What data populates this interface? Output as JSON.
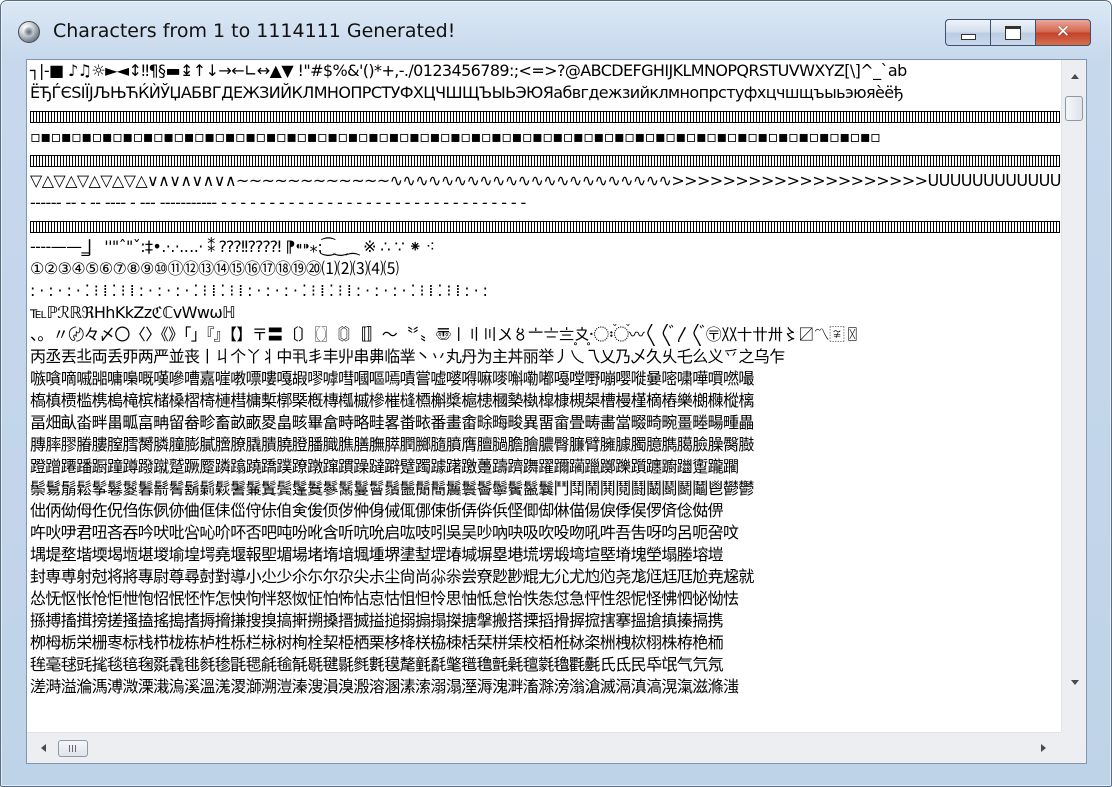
{
  "window": {
    "title": "Characters from 1 to 1114111 Generated!"
  },
  "content": {
    "lines": [
      {
        "text": " ┐|-■ ♪♫☼►◄↕‼¶§▬↨↑↓→←∟↔▲▼ !\"#$%&'()*+,-./0123456789:;<=>?@ABCDEFGHIJKLMNOPQRSTUVWXYZ[\\]^_`ab"
      },
      {
        "text": "ЁЂЃЄЅІЇЈЉЊЋЌЍЎЏАБВГДЕЖЗИЙКЛМНОПРСТУФХЦЧШЩЪЫЬЭЮЯабвгдежзийклмнопрстуфхцчшщъыьэюяѐёђ"
      },
      {
        "text": "",
        "box": true
      },
      {
        "text": "▫▪▫▪▫▪▫▪▫▪▫▪▫▪▫▪▫▪▫▪▫▪▫▪▫▪▫▪▫▪▫▪▫▪▫▪▫▪▫▪▫▪▫▪▫▪▫▪▫▪▫▪▫▪▫▪▫▪▫▪▫▪▫▪▫▪▫▪▫▪▫▪▫▪▫▪▫▪▫▪▫▪▫"
      },
      {
        "text": "",
        "box": true
      },
      {
        "text": "▽△▽△▽△▽△▽△∨∧∨∧∨∧∨∧~~~~~~~~~~~~∿∿∿∿∿∿∿∿∿∿∿∿∿∿∿∿∿∿∿∿∿∿>>>>>>>>>>>>>>>>>>>>ᑌᑌᑌᑌᑌᑌᑌᑌᑌᑌᑌᑌᑌᑌᑌᑌᑌ"
      },
      {
        "text": "------ -- - -- ---- - --- ----------- - - - - - - - - - - - - - - - - - - - - - - - - - - - - - - - -"
      },
      {
        "text": "",
        "box": true
      },
      {
        "text": "    ----——‗⎸''\"ˆ\"ˇ:‡•.·.·.‥.·   ⁑      ⁇⁈⁉⁇⁈    ⁋⁌⁍⁎⁏⁐‿⁔   ※  ∴  ∵   ⁕       ⁖      "
      },
      {
        "text": "                                                  ①②③④⑤⑥⑦⑧⑨⑩⑪⑫⑬⑭⑮⑯⑰⑱⑲⑳⑴⑵⑶⑷⑸"
      },
      {
        "text": ": · : · : · ⁚ ⁝ ⁞ ⁚ ⁝ ⁞ : · : · : · ⁚ ⁝ ⁞ ⁚ ⁝ ⁞ : · : · : · ⁚ ⁝ ⁞ ⁚ ⁝ ⁞ : · : · : · ⁚ ⁝ ⁞ ⁚ ⁝ ⁞ : · :"
      },
      {
        "text": "                                                   ℡ℙℛℝℜHhKkZzℭℂvWwѡℍ   "
      },
      {
        "text": "、。〃〄々〆〇〈〉《》「」『』【】〒〓〔〕〖〗〘〙〚〛〜〝〞〟〠〡〢〣〤〥〦〧〨〩〪〭〮〯〫〬〰〱〲〳〴〵〶〷〸〹〺〻〼〽〾〿"
      },
      {
        "text": "丙丞丟丠両丢丣两严並丧丨丩个丫丬中丮丯丰丱串丳临丵丶丷丸丹为主丼丽举丿乀乁乂乃乄久乆乇么义乊之乌乍"
      },
      {
        "text": "嗾嗿嘀嘁嘂嘃嘄嘅嘆嘇嘈嘉嘊嘋嘌嘍嘎嘏嘐嘑嘒嘓嘔嘕嘖嘗嘘嘙嘚嘛嘜嘝嘞嘟嘠嘡嘢嘣嘤嘥嘦嘧嘨嘩嘪嘫嘬"
      },
      {
        "text": "槗槙槚槛槜槝槞槟槠槡槢槣槤槥槦槧槨槩槪槫槬槭槮槯槰槱槲槳槴槵槶槷槸槹槺槻槼槽槾槿樀樁樂樃樄樅樆"
      },
      {
        "text": "畐畑畒畓畔畕畖畗畘留畚畛畜畝畞畟畠畡畢畣畤略畦畧畨畩番畫畬畭畮畯異畱畲畳畴畵當畷畸畹畺畻畼畽畾"
      },
      {
        "text": "膞膟膠膡膢膣膤膥膦膧膨膩膪膫膬膭膮膯膰膱膲膳膴膵膶膷膸膹膺膻膼膽膾膿臀臁臂臃臄臅臆臇臈臉臊臋臌"
      },
      {
        "text": "蹬蹭蹮蹯蹰蹱蹲蹳蹴蹵蹶蹷蹸蹹蹺蹻蹼蹽蹾蹿躀躁躂躃躄躅躆躇躈躉躊躋躌躍躎躏躐躑躒躓躔躕躖躗躘躙"
      },
      {
        "text": "鬃鬄鬅鬆鬇鬈鬉鬊鬋鬌鬍鬎鬏鬐鬑鬒鬓鬔鬕鬖鬗鬘鬙鬚鬛鬜鬝鬞鬟鬠鬡鬢鬣鬤鬥鬦鬧鬨鬩鬪鬫鬬鬭鬮鬯鬰鬱"
      },
      {
        "text": "㑁㑂㑃㑄㑅㑆㑇㑈㑉㑊㑋㑌㑍㑎㑏㑐㑑㑒㑓㑔㑕㑖㑗㑘㑙㑚㑛㑜㑝㑞㑟㑠㑡㑢㑣㑤㑥㑦㑧㑨㑩㑪㑫㑬㑭"
      },
      {
        "text": "吘吙吚君吜吝吞吟吠吡吢吣吤吥否吧吨吩吪含听吭吮启吰吱吲吳吴吵吶吷吸吹吺吻吼吽吾吿呀呁呂呃呄呅"
      },
      {
        "text": "堣堤堥堦堧堨堩堪堫堬堭堮堯堰報堲堳場堵堶堷堸堹堺堻堼堽堾堿塀塁塂塃塄塅塆塇塈塉塊塋塌塍塎塏"
      },
      {
        "text": "封専尃射尅将將專尉尊尋尌對導小尐少尒尓尔尕尖尗尘尙尚尛尜尝尞尟尠尡尢尣尤尥尦尧尨尩尪尫尬尭尮就"
      },
      {
        "text": "怂怃怄怅怆怇怈怉怊怋怌怍怎怏怐怑怒怓怔怕怖怗怘怙怚怛怜思怞怟怠怡怢怣怤急怦性怨怩怪怫怬怭怮怯"
      },
      {
        "text": "搎搏搐搑搒搓搔搕搖搗搘搙搚搛搜搝搞搟搠搡搢搣搤搥搦搧搨搩搪搫搬搭搮搯搰搱搲搳搴搵搶搷搸搹携"
      },
      {
        "text": "栁栂栃栄栅栆标栈栉栊栋栌栍栎栏栐树栒栓栔栕栖栗栘栙栚栛栜栝栞栟栠校栢栣栤栥栦栧栨栩株栫栬栭"
      },
      {
        "text": "毪毫毬毭毮毯毰毱毲毳毴毵毶毷毸毹毺毻毼毽毾毿氀氁氂氃氄氅氆氇氈氉氊氋氌氍氎氏氐民氒氓气氕氖"
      },
      {
        "text": "溠溡溢溣溤溥溦溧溨溩溪溫溬溭溮溯溰溱溲溳溴溵溶溷溸溹溺溻溼溽溾溿滀滁滂滃滄滅滆滇滈滉滊滋滌滍"
      }
    ]
  }
}
